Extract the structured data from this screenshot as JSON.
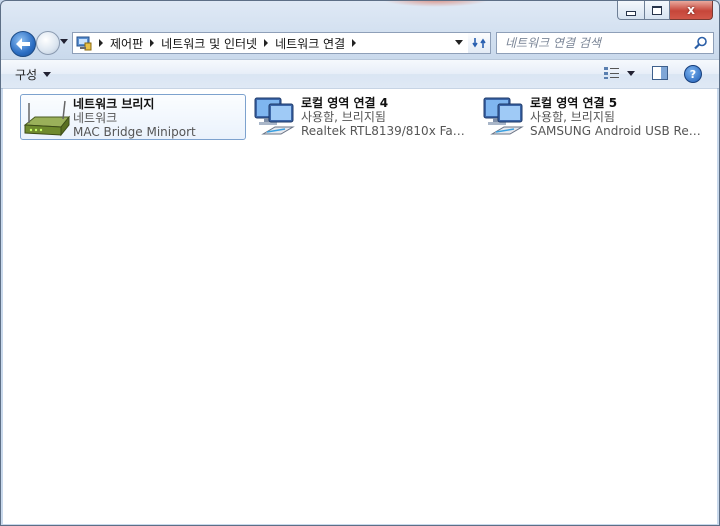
{
  "window": {
    "minimize_label": "",
    "close_label": "x"
  },
  "address": {
    "crumbs": [
      "제어판",
      "네트워크 및 인터넷",
      "네트워크 연결"
    ]
  },
  "search": {
    "placeholder": "네트워크 연결 검색"
  },
  "toolbar": {
    "organize_label": "구성",
    "help_label": "?"
  },
  "items": [
    {
      "name": "네트워크 브리지",
      "status": "네트워크",
      "device": "MAC Bridge Miniport",
      "icon": "network-bridge-icon",
      "selected": true
    },
    {
      "name": "로컬 영역 연결 4",
      "status": "사용함, 브리지됨",
      "device": "Realtek RTL8139/810x Family Fa...",
      "icon": "lan-connection-icon",
      "selected": false
    },
    {
      "name": "로컬 영역 연결 5",
      "status": "사용함, 브리지됨",
      "device": "SAMSUNG Android USB Remote...",
      "icon": "lan-connection-icon",
      "selected": false
    }
  ],
  "colors": {
    "accent": "#2d6fc4",
    "selection_border": "#7da2ce",
    "close_button": "#c6463a"
  }
}
